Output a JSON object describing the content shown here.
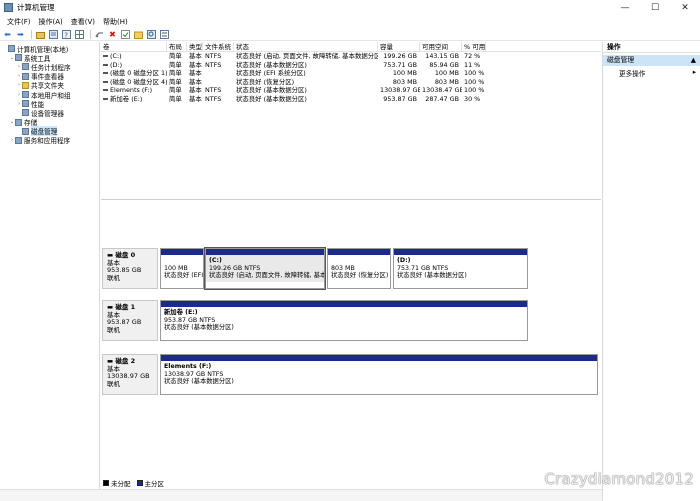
{
  "window": {
    "title": "计算机管理",
    "minimize": "—",
    "maximize": "☐",
    "close": "✕"
  },
  "menu": [
    "文件(F)",
    "操作(A)",
    "查看(V)",
    "帮助(H)"
  ],
  "toolbar_icons": [
    "back-arrow-icon",
    "forward-arrow-icon",
    "up-folder-icon",
    "properties-icon",
    "help-icon",
    "grid-icon",
    "connect-icon",
    "delete-icon",
    "check-icon",
    "folder-icon",
    "search-icon",
    "list-icon"
  ],
  "tree": [
    {
      "label": "计算机管理(本地)",
      "depth": 0,
      "twisty": "",
      "icon": "computer"
    },
    {
      "label": "系统工具",
      "depth": 1,
      "twisty": "⌄",
      "icon": "tools"
    },
    {
      "label": "任务计划程序",
      "depth": 2,
      "twisty": "›",
      "icon": "task"
    },
    {
      "label": "事件查看器",
      "depth": 2,
      "twisty": "›",
      "icon": "event"
    },
    {
      "label": "共享文件夹",
      "depth": 2,
      "twisty": "›",
      "icon": "folder"
    },
    {
      "label": "本地用户和组",
      "depth": 2,
      "twisty": "›",
      "icon": "users"
    },
    {
      "label": "性能",
      "depth": 2,
      "twisty": "›",
      "icon": "perf"
    },
    {
      "label": "设备管理器",
      "depth": 2,
      "twisty": "",
      "icon": "device"
    },
    {
      "label": "存储",
      "depth": 1,
      "twisty": "⌄",
      "icon": "storage"
    },
    {
      "label": "磁盘管理",
      "depth": 2,
      "twisty": "",
      "icon": "disk",
      "selected": true
    },
    {
      "label": "服务和应用程序",
      "depth": 1,
      "twisty": "›",
      "icon": "services"
    }
  ],
  "table": {
    "headers": [
      "卷",
      "布局",
      "类型",
      "文件系统",
      "状态",
      "容量",
      "可用空间",
      "% 可用"
    ],
    "rows": [
      [
        "(C:)",
        "简单",
        "基本",
        "NTFS",
        "状态良好 (启动, 页面文件, 故障转储, 基本数据分区)",
        "199.26 GB",
        "143.15 GB",
        "72 %"
      ],
      [
        "(D:)",
        "简单",
        "基本",
        "NTFS",
        "状态良好 (基本数据分区)",
        "753.71 GB",
        "85.94 GB",
        "11 %"
      ],
      [
        "(磁盘 0 磁盘分区 1)",
        "简单",
        "基本",
        "",
        "状态良好 (EFI 系统分区)",
        "100 MB",
        "100 MB",
        "100 %"
      ],
      [
        "(磁盘 0 磁盘分区 4)",
        "简单",
        "基本",
        "",
        "状态良好 (恢复分区)",
        "803 MB",
        "803 MB",
        "100 %"
      ],
      [
        "Elements (F:)",
        "简单",
        "基本",
        "NTFS",
        "状态良好 (基本数据分区)",
        "13038.97 GB",
        "13038.47 GB",
        "100 %"
      ],
      [
        "新加卷 (E:)",
        "简单",
        "基本",
        "NTFS",
        "状态良好 (基本数据分区)",
        "953.87 GB",
        "287.47 GB",
        "30 %"
      ]
    ]
  },
  "disks": [
    {
      "name": "磁盘 0",
      "type": "基本",
      "size": "953.85 GB",
      "status": "联机",
      "partitions": [
        {
          "title": "",
          "size": "100 MB",
          "status": "状态良好 (EFI"
        },
        {
          "title": "(C:)",
          "size": "199.26 GB NTFS",
          "status": "状态良好 (启动, 页面文件, 故障转储, 基本",
          "selected": true
        },
        {
          "title": "",
          "size": "803 MB",
          "status": "状态良好 (恢复分区)"
        },
        {
          "title": "(D:)",
          "size": "753.71 GB NTFS",
          "status": "状态良好 (基本数据分区)"
        }
      ]
    },
    {
      "name": "磁盘 1",
      "type": "基本",
      "size": "953.87 GB",
      "status": "联机",
      "partitions": [
        {
          "title": "新加卷 (E:)",
          "size": "953.87 GB NTFS",
          "status": "状态良好 (基本数据分区)"
        }
      ]
    },
    {
      "name": "磁盘 2",
      "type": "基本",
      "size": "13038.97 GB",
      "status": "联机",
      "partitions": [
        {
          "title": "Elements (F:)",
          "size": "13038.97 GB NTFS",
          "status": "状态良好 (基本数据分区)"
        }
      ]
    }
  ],
  "legend": [
    {
      "label": "未分配",
      "color": "#000000"
    },
    {
      "label": "主分区",
      "color": "#1c2a8a"
    }
  ],
  "actions": {
    "header": "操作",
    "section": "磁盘管理",
    "section_arrow": "▲",
    "items": [
      {
        "label": "更多操作",
        "arrow": "▸"
      }
    ]
  },
  "watermark": "Crazydiamond2012"
}
